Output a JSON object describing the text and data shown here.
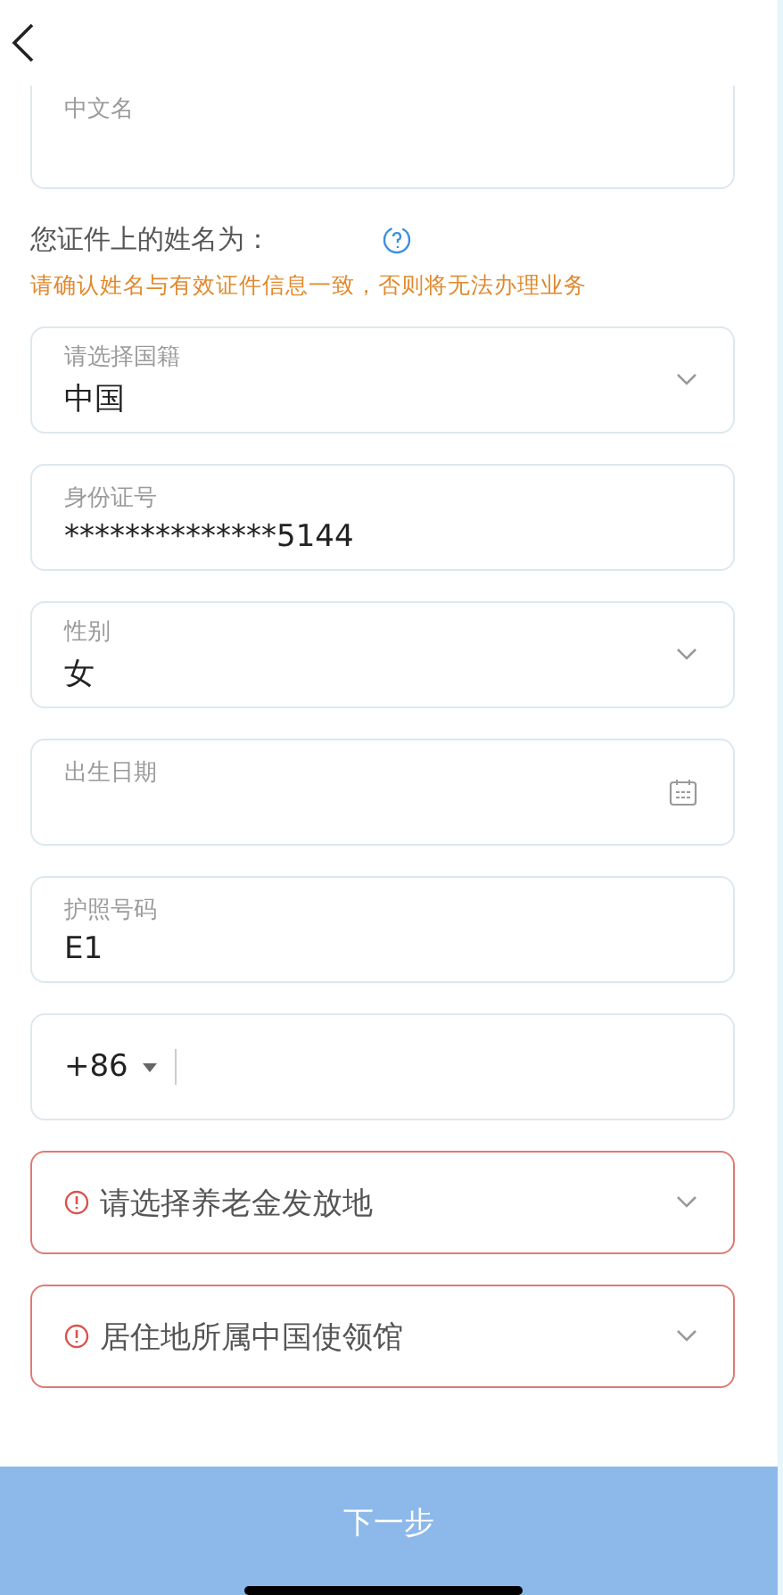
{
  "name_field": {
    "label": "中文名"
  },
  "name_notice": {
    "text": "您证件上的姓名为：",
    "warning": "请确认姓名与有效证件信息一致，否则将无法办理业务"
  },
  "fields": [
    {
      "kind": "select",
      "label": "请选择国籍",
      "value": "中国",
      "error": false
    },
    {
      "kind": "text",
      "label": "身份证号",
      "value": "**************5144",
      "error": false
    },
    {
      "kind": "select",
      "label": "性别",
      "value": "女",
      "error": false
    },
    {
      "kind": "date",
      "label": "出生日期",
      "error": false
    },
    {
      "kind": "text",
      "label": "护照号码",
      "value": "E1",
      "error": false
    },
    {
      "kind": "phone",
      "code": "+86",
      "error": false
    },
    {
      "kind": "select",
      "placeholder": "请选择养老金发放地",
      "error": true
    },
    {
      "kind": "select",
      "placeholder": "居住地所属中国使领馆",
      "error": true
    }
  ],
  "next_button": {
    "label": "下一步",
    "disabled": true
  }
}
